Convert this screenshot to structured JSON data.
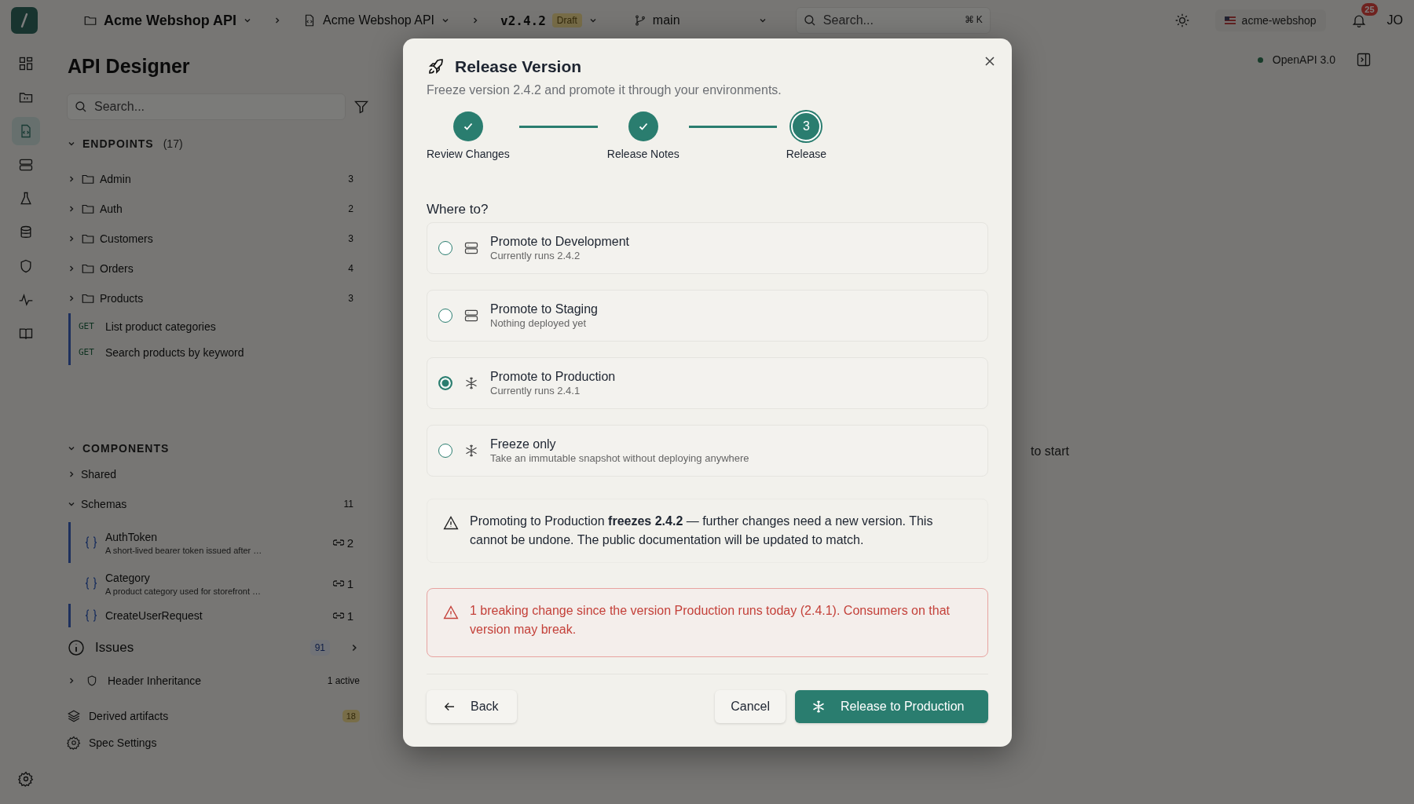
{
  "topbar": {
    "project": "Acme Webshop API",
    "spec": "Acme Webshop API",
    "version": "v2.4.2",
    "version_badge": "Draft",
    "branch": "main",
    "search": {
      "placeholder": "Search...",
      "shortcut": "⌘ K"
    },
    "workspace": "acme-webshop",
    "notifications": "25",
    "avatar": "JO"
  },
  "nav_rail": [
    {
      "selected": false
    },
    {
      "selected": false
    },
    {
      "selected": true
    },
    {
      "selected": false
    },
    {
      "selected": false
    },
    {
      "selected": false
    },
    {
      "selected": false
    },
    {
      "selected": false
    },
    {
      "selected": false
    }
  ],
  "sidebar": {
    "title": "API Designer",
    "search": {
      "placeholder": "Search..."
    },
    "endpoints": {
      "label": "ENDPOINTS",
      "count": "(17)",
      "expanded": true,
      "folders": [
        {
          "name": "Admin",
          "count": "3",
          "expanded": false
        },
        {
          "name": "Auth",
          "count": "2",
          "expanded": false
        },
        {
          "name": "Customers",
          "count": "3",
          "expanded": false
        },
        {
          "name": "Orders",
          "count": "4",
          "expanded": false
        },
        {
          "name": "Products",
          "count": "3",
          "expanded": false
        }
      ],
      "items": [
        {
          "method": "GET",
          "name": "List product categories",
          "marked": true
        },
        {
          "method": "GET",
          "name": "Search products by keyword",
          "marked": true
        }
      ]
    },
    "components": {
      "label": "COMPONENTS",
      "expanded": true,
      "groups": [
        {
          "name": "Shared",
          "expanded": false
        },
        {
          "name": "Schemas",
          "count": "11",
          "expanded": true
        }
      ],
      "schemas": [
        {
          "name": "AuthToken",
          "description": "A short-lived bearer token issued after …",
          "refs": "2",
          "marked": true
        },
        {
          "name": "Category",
          "description": "A product category used for storefront …",
          "refs": "1",
          "marked": false
        },
        {
          "name": "CreateUserRequest",
          "refs": "1",
          "marked": true
        }
      ]
    },
    "issues": {
      "label": "Issues",
      "count": "91"
    },
    "header_inheritance": {
      "label": "Header Inheritance",
      "status": "1 active",
      "expanded": false
    },
    "derived_artifacts": {
      "label": "Derived artifacts",
      "count": "18"
    },
    "spec_settings": "Spec Settings"
  },
  "main": {
    "format": "OpenAPI 3.0",
    "hint": "to start"
  },
  "dialog": {
    "title": "Release Version",
    "subtitle": "Freeze version 2.4.2 and promote it through your environments.",
    "steps": [
      {
        "label": "Review Changes",
        "completed": true
      },
      {
        "label": "Release Notes",
        "completed": true
      },
      {
        "label": "Release",
        "completed": false,
        "number": "3"
      }
    ],
    "question": "Where to?",
    "options": [
      {
        "kind": "server",
        "title": "Promote to Development",
        "detail": "Currently runs 2.4.2",
        "selected": false
      },
      {
        "kind": "server",
        "title": "Promote to Staging",
        "detail": "Nothing deployed yet",
        "selected": false
      },
      {
        "kind": "snowflake",
        "title": "Promote to Production",
        "detail": "Currently runs 2.4.1",
        "selected": true
      },
      {
        "kind": "snowflake",
        "title": "Freeze only",
        "detail": "Take an immutable snapshot without deploying anywhere",
        "selected": false
      }
    ],
    "notice": "Promoting to Production **freezes 2.4.2** — further changes need a new version. This cannot be undone. The public documentation will be updated to match.",
    "warning": "1 breaking change since the version Production runs today (2.4.1). Consumers on that version may break.",
    "buttons": {
      "back": "Back",
      "cancel": "Cancel",
      "confirm": "Release to Production"
    }
  }
}
